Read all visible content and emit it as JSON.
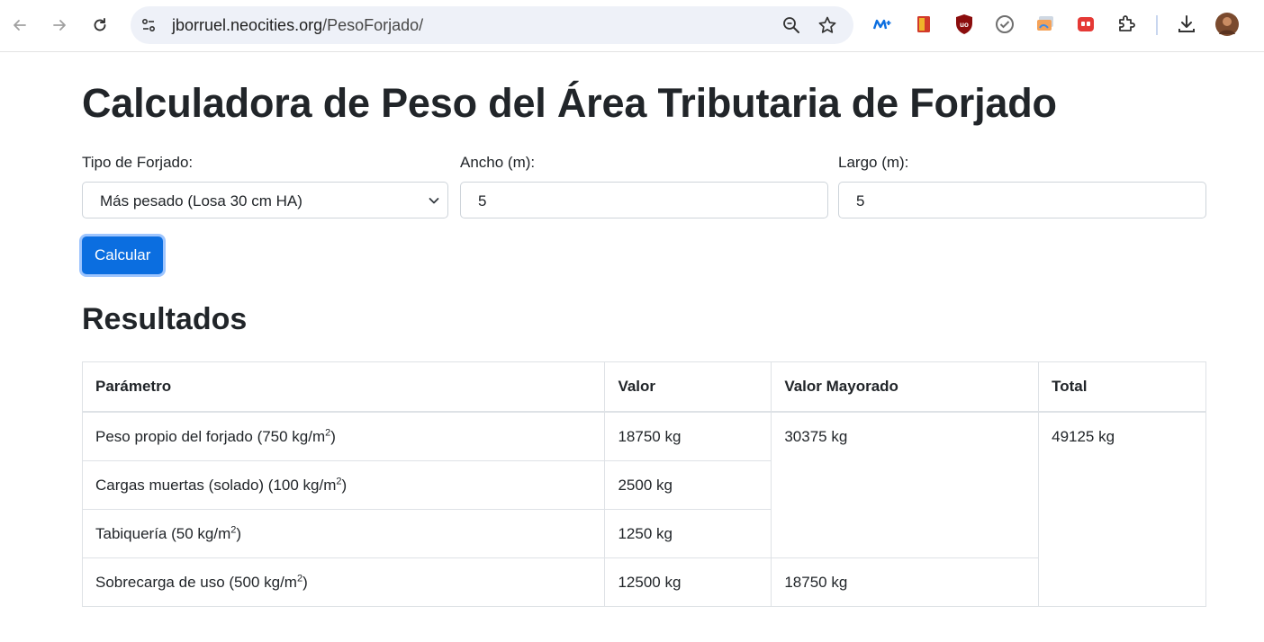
{
  "browser": {
    "url_host": "jborruel.neocities.org",
    "url_path": "/PesoForjado/"
  },
  "form": {
    "tipo_label": "Tipo de Forjado:",
    "tipo_value": "Más pesado (Losa 30 cm HA)",
    "ancho_label": "Ancho (m):",
    "ancho_value": "5",
    "largo_label": "Largo (m):",
    "largo_value": "5",
    "calc_button": "Calcular"
  },
  "page": {
    "title": "Calculadora de Peso del Área Tributaria de Forjado",
    "results_title": "Resultados"
  },
  "table": {
    "headers": [
      "Parámetro",
      "Valor",
      "Valor Mayorado",
      "Total"
    ],
    "rows": [
      {
        "param": "Peso propio del forjado (750 kg/m",
        "sup": "2",
        "close": ")",
        "valor": "18750 kg"
      },
      {
        "param": "Cargas muertas (solado) (100 kg/m",
        "sup": "2",
        "close": ")",
        "valor": "2500 kg"
      },
      {
        "param": "Tabiquería (50 kg/m",
        "sup": "2",
        "close": ")",
        "valor": "1250 kg"
      },
      {
        "param": "Sobrecarga de uso (500 kg/m",
        "sup": "2",
        "close": ")",
        "valor": "12500 kg"
      }
    ],
    "mayorado_1": "30375 kg",
    "mayorado_2": "18750 kg",
    "total": "49125 kg"
  },
  "colors": {
    "accent": "#0b6ee0",
    "text": "#212529"
  }
}
